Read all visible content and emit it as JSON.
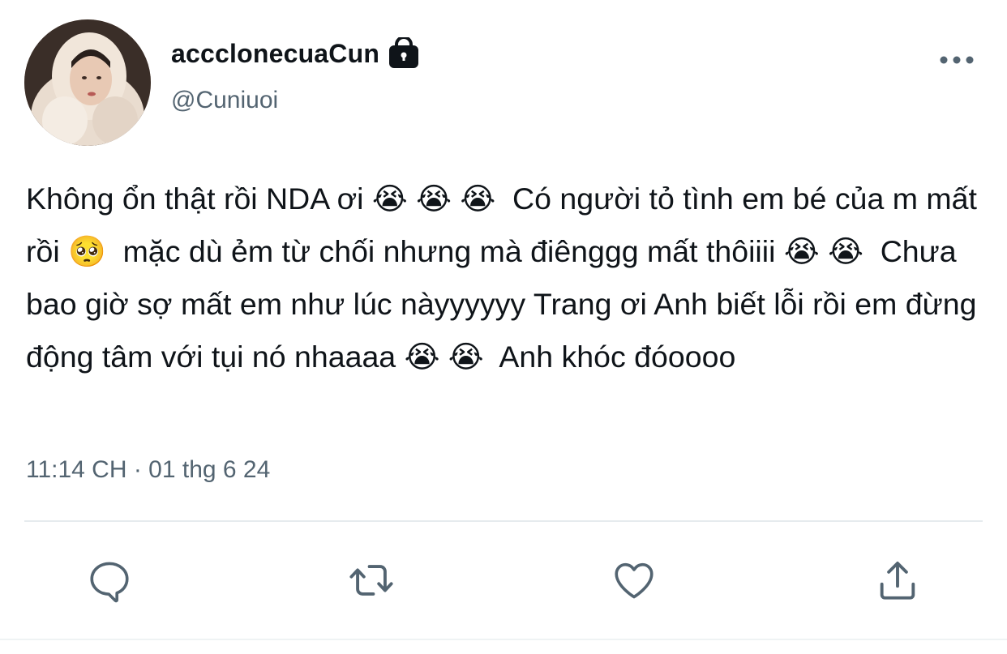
{
  "user": {
    "display_name": "accclonecuaCun",
    "handle": "@Cuniuoi"
  },
  "tweet": {
    "text": "Không ổn thật rồi NDA ơi 😭 😭 😭  Có người tỏ tình em bé của m mất rồi 🥺  mặc dù ẻm từ chối nhưng mà điênggg mất thôiiii 😭 😭  Chưa bao giờ sợ mất em như lúc nàyyyyyy Trang ơi Anh biết lỗi rồi em đừng động tâm với tụi nó nhaaaa 😭 😭  Anh khóc đóoooo",
    "timestamp": "11:14 CH · 01 thg 6 24"
  },
  "icons": {
    "lock": "lock-icon",
    "more": "more-icon",
    "reply": "reply-icon",
    "retweet": "retweet-icon",
    "like": "heart-icon",
    "share": "share-icon"
  },
  "colors": {
    "text": "#0f1419",
    "secondary": "#536471",
    "divider": "#e6ebee"
  }
}
